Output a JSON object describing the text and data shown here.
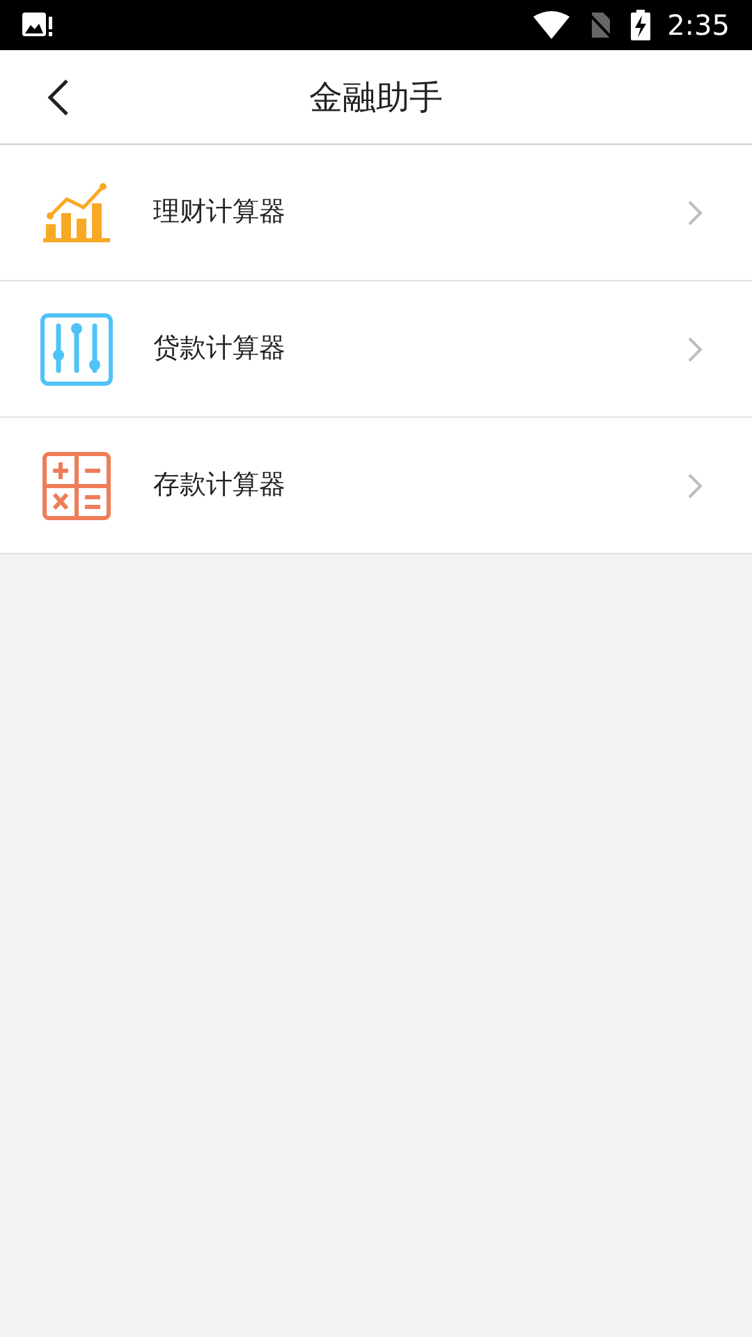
{
  "status_bar": {
    "time": "2:35"
  },
  "header": {
    "title": "金融助手"
  },
  "items": [
    {
      "kind": "chart",
      "label": "理财计算器"
    },
    {
      "kind": "sliders",
      "label": "贷款计算器"
    },
    {
      "kind": "calculator",
      "label": "存款计算器"
    }
  ]
}
